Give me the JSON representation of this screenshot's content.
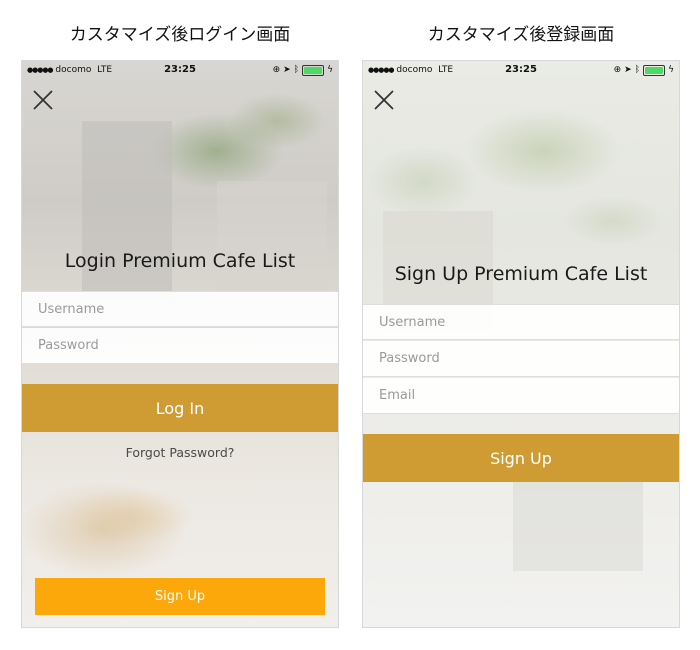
{
  "captions": {
    "left": "カスタマイズ後ログイン画面",
    "right": "カスタマイズ後登録画面"
  },
  "status_bar": {
    "signal": "●●●●●",
    "carrier": "docomo",
    "network": "LTE",
    "time": "23:25",
    "icons": [
      "rotation-lock-icon",
      "location-icon",
      "bluetooth-icon",
      "battery-icon"
    ],
    "battery_level": 1.0
  },
  "login_screen": {
    "title": "Login Premium Cafe List",
    "username_placeholder": "Username",
    "password_placeholder": "Password",
    "login_button": "Log In",
    "forgot_password": "Forgot Password?",
    "signup_button": "Sign Up"
  },
  "signup_screen": {
    "title": "Sign Up Premium Cafe List",
    "username_placeholder": "Username",
    "password_placeholder": "Password",
    "email_placeholder": "Email",
    "signup_button": "Sign Up"
  },
  "colors": {
    "primary_button": "#cf9b33",
    "signup_bottom_button": "#fca80a",
    "battery_fill": "#4cd964"
  }
}
